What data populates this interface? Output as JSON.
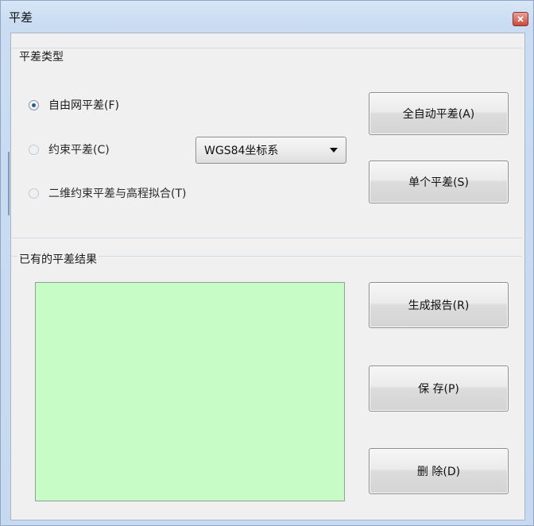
{
  "window": {
    "title": "平差"
  },
  "adjust_type_group": {
    "title": "平差类型",
    "options": [
      {
        "label": "自由网平差(F)",
        "checked": true
      },
      {
        "label": "约束平差(C)",
        "checked": false
      },
      {
        "label": "二维约束平差与高程拟合(T)",
        "checked": false
      }
    ],
    "coordinate_system": {
      "selected": "WGS84坐标系"
    },
    "buttons": {
      "auto_adjust": "全自动平差(A)",
      "single_adjust": "单个平差(S)"
    }
  },
  "results_group": {
    "title": "已有的平差结果",
    "list_background": "#c7fcc7",
    "buttons": {
      "report": "生成报告(R)",
      "save": "保 存(P)",
      "delete": "删 除(D)"
    }
  },
  "icons": {
    "close": "close-icon",
    "dropdown": "chevron-down-icon"
  }
}
